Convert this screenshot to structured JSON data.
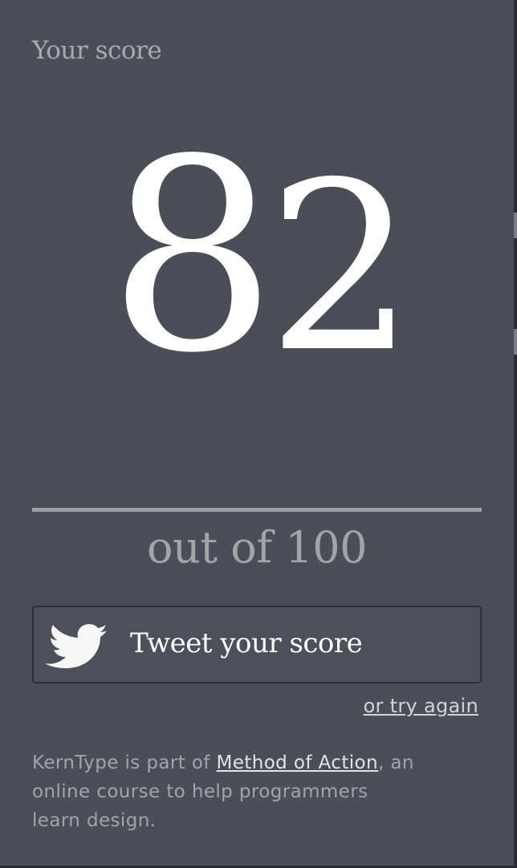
{
  "score_card": {
    "heading": "Your score",
    "score_first_digit": "8",
    "score_second_digit": "2",
    "out_of": "out of 100"
  },
  "tweet_button": {
    "icon": "twitter-bird-icon",
    "label": "Tweet your score"
  },
  "try_again_link": "or try again",
  "footer": {
    "prefix": "KernType is part of ",
    "link_text": "Method of Action",
    "suffix": ", an",
    "line2": "online course to help programmers",
    "line3": "learn design."
  },
  "colors": {
    "background": "#4c4d57",
    "score_text": "#ffffff",
    "muted_text": "#a3a3a8",
    "rule": "#9c9ca1",
    "button_border": "#2f3037"
  }
}
